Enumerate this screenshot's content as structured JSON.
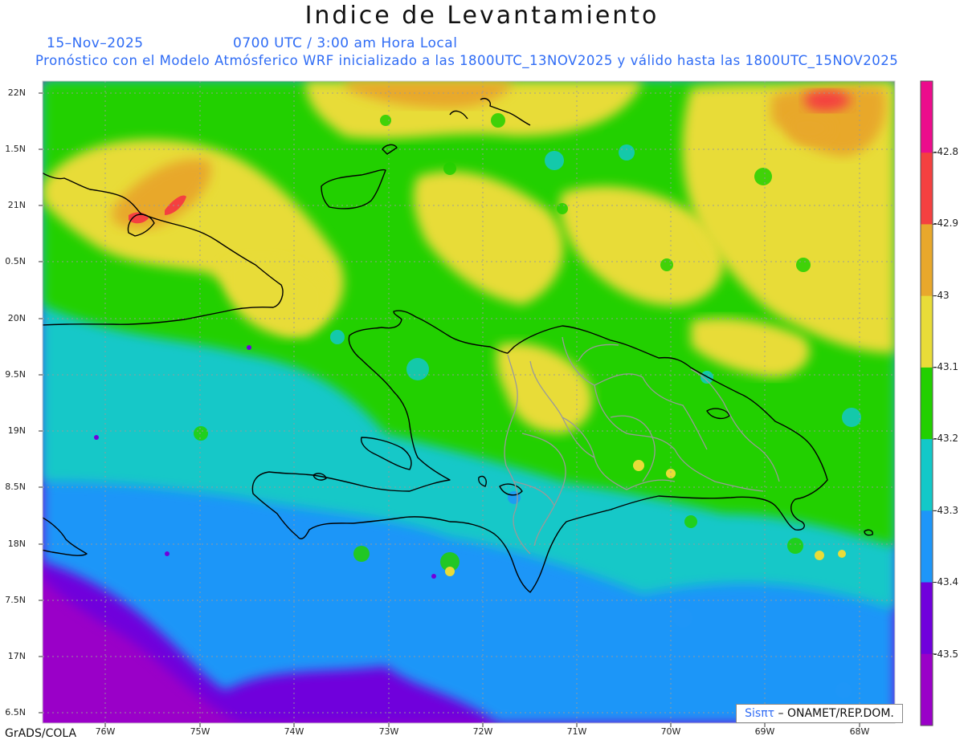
{
  "title": "Indice de Levantamiento",
  "date": "15–Nov–2025",
  "time_label": "0700 UTC / 3:00 am Hora Local",
  "description": "Pronóstico con el Modelo Atmósferico WRF inicializado a las 1800UTC_13NOV2025 y válido hasta las  1800UTC_15NOV2025",
  "footer": "GrADS/COLA",
  "logo": {
    "prefix": "Sis",
    "symbol": "πτ",
    "suffix": "– ONAMET/REP.DOM."
  },
  "map": {
    "lat_range": [
      16.4,
      22.1
    ],
    "lon_range": [
      -76.7,
      -67.4
    ],
    "lat_labels": [
      "22N",
      "1.5N",
      "21N",
      "0.5N",
      "20N",
      "9.5N",
      "19N",
      "8.5N",
      "18N",
      "7.5N",
      "17N",
      "6.5N"
    ],
    "lon_labels": [
      "76W",
      "75W",
      "74W",
      "73W",
      "72W",
      "71W",
      "70W",
      "69W",
      "68W"
    ]
  },
  "colorbar": {
    "colors": [
      "#ec0c8c",
      "#f44040",
      "#e8a82c",
      "#e8dc38",
      "#22d000",
      "#12c8c8",
      "#1e96f8",
      "#7000dc",
      "#9a00c8"
    ],
    "labels": [
      "-42.8",
      "-42.9",
      "-43",
      "-43.1",
      "-43.2",
      "-43.3",
      "-43.4",
      "-43.5"
    ]
  }
}
